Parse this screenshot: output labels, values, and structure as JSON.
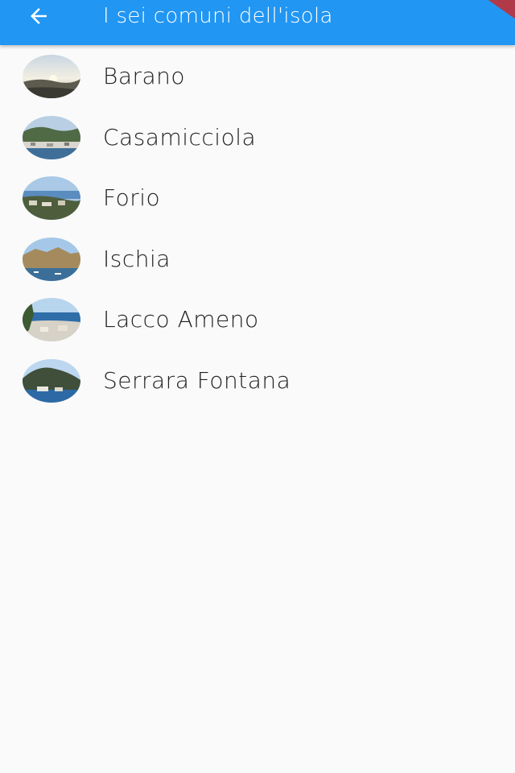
{
  "appbar": {
    "title": "I sei comuni dell'isola",
    "back_icon": "arrow-back-icon",
    "color": "#2196f3"
  },
  "list": {
    "items": [
      {
        "label": "Barano"
      },
      {
        "label": "Casamicciola"
      },
      {
        "label": "Forio"
      },
      {
        "label": "Ischia"
      },
      {
        "label": "Lacco Ameno"
      },
      {
        "label": "Serrara Fontana"
      }
    ]
  }
}
